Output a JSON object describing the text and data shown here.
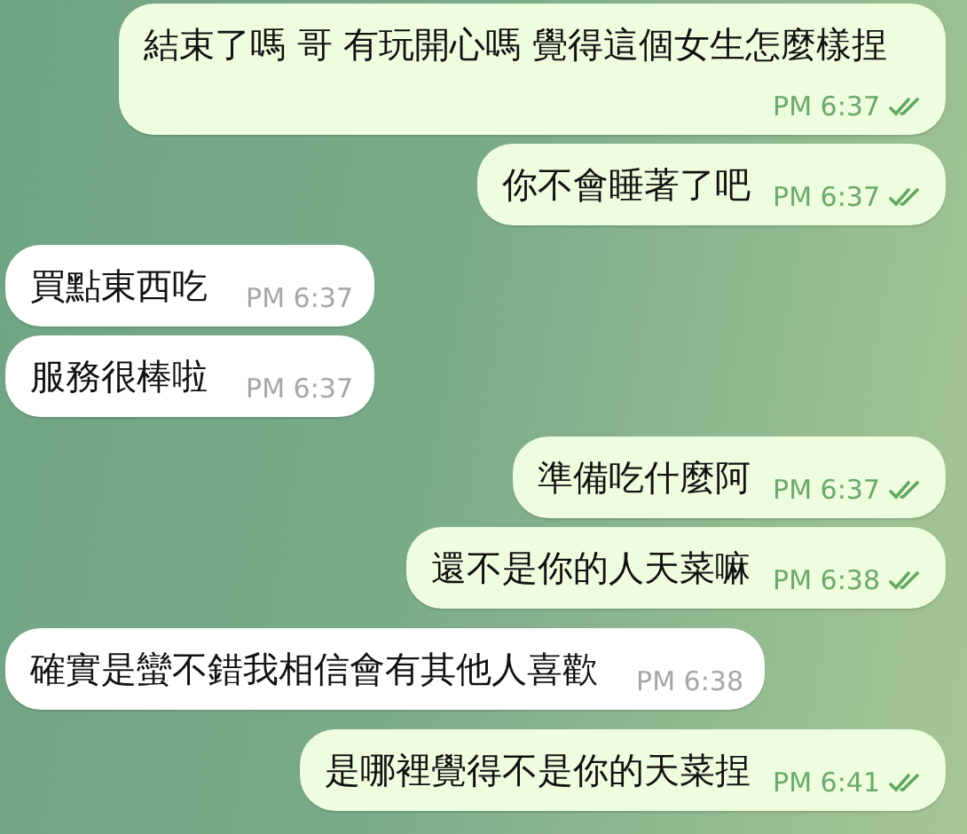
{
  "messages": [
    {
      "text": "結束了嗎 哥 有玩開心嗎 覺得這個女生怎麼樣捏",
      "time": "PM 6:37",
      "outgoing": true,
      "read": true
    },
    {
      "text": "你不會睡著了吧",
      "time": "PM 6:37",
      "outgoing": true,
      "read": true
    },
    {
      "text": "買點東西吃",
      "time": "PM 6:37",
      "outgoing": false
    },
    {
      "text": "服務很棒啦",
      "time": "PM 6:37",
      "outgoing": false
    },
    {
      "text": "準備吃什麼阿",
      "time": "PM 6:37",
      "outgoing": true,
      "read": true
    },
    {
      "text": "還不是你的人天菜嘛",
      "time": "PM 6:38",
      "outgoing": true,
      "read": true
    },
    {
      "text": "確實是蠻不錯我相信會有其他人喜歡",
      "time": "PM 6:38",
      "outgoing": false
    },
    {
      "text": "是哪裡覺得不是你的天菜捏",
      "time": "PM 6:41",
      "outgoing": true,
      "read": true
    }
  ]
}
